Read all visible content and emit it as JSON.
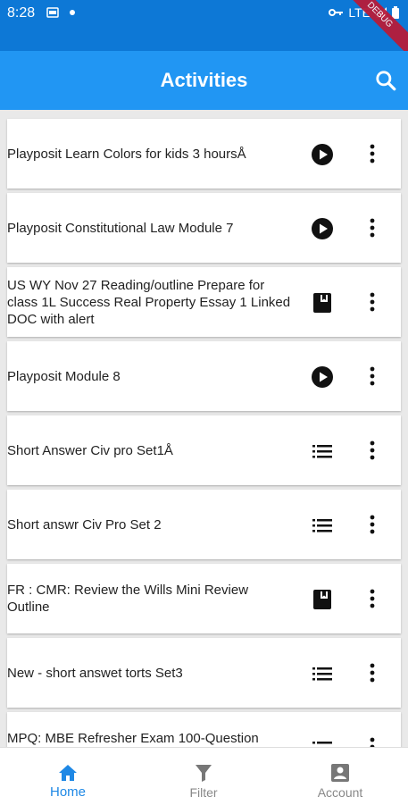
{
  "status_bar": {
    "time": "8:28",
    "network": "LTE",
    "ribbon": "DEBUG"
  },
  "app_bar": {
    "title": "Activities",
    "search_icon": "search-icon"
  },
  "activities": [
    {
      "title": "Playposit Learn Colors for kids 3 hoursÅ",
      "icon": "play-circle-icon"
    },
    {
      "title": "Playposit Constitutional Law Module 7",
      "icon": "play-circle-icon"
    },
    {
      "title": "US WY Nov 27 Reading/outline Prepare for class 1L Success Real Property Essay 1 Linked DOC with alert",
      "icon": "book-icon"
    },
    {
      "title": "Playposit Module 8",
      "icon": "play-circle-icon"
    },
    {
      "title": "Short Answer Civ pro Set1Å",
      "icon": "list-icon"
    },
    {
      "title": "Short answr Civ Pro Set 2",
      "icon": "list-icon"
    },
    {
      "title": "FR : CMR: Review the Wills Mini Review Outline",
      "icon": "book-icon"
    },
    {
      "title": "New - short answet torts Set3",
      "icon": "list-icon"
    },
    {
      "title": "MPQ: MBE Refresher Exam 100-Question",
      "icon": "list-icon"
    }
  ],
  "bottom_nav": {
    "home": "Home",
    "filter": "Filter",
    "account": "Account"
  },
  "colors": {
    "status_bar": "#0d78d6",
    "app_bar": "#2196f3",
    "active": "#1e88e5"
  }
}
